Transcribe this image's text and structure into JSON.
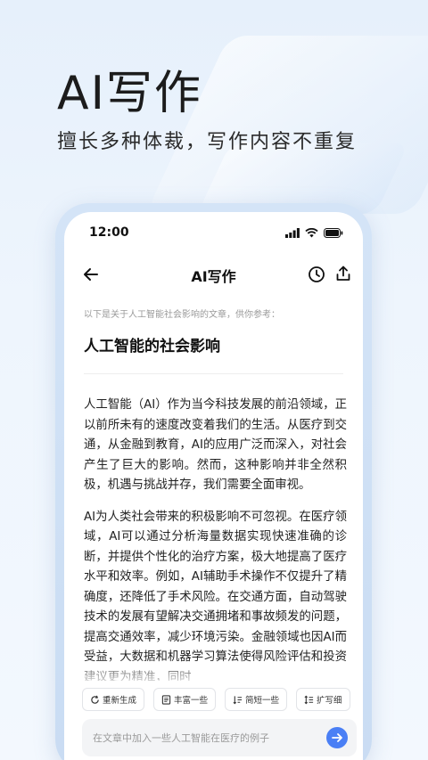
{
  "hero": {
    "title": "AI写作",
    "subtitle": "擅长多种体裁，写作内容不重复"
  },
  "status_bar": {
    "time": "12:00"
  },
  "navbar": {
    "title": "AI写作"
  },
  "article": {
    "intro": "以下是关于人工智能社会影响的文章，供你参考：",
    "title": "人工智能的社会影响",
    "paragraphs": [
      "人工智能（AI）作为当今科技发展的前沿领域，正以前所未有的速度改变着我们的生活。从医疗到交通，从金融到教育，AI的应用广泛而深入，对社会产生了巨大的影响。然而，这种影响并非全然积极，机遇与挑战并存，我们需要全面审视。",
      "AI为人类社会带来的积极影响不可忽视。在医疗领域，AI可以通过分析海量数据实现快速准确的诊断，并提供个性化的治疗方案，极大地提高了医疗水平和效率。例如，AI辅助手术操作不仅提升了精确度，还降低了手术风险。在交通方面，自动驾驶技术的发展有望解决交通拥堵和事故频发的问题，提高交通效率，减少环境污染。金融领域也因AI而受益，大数据和机器学习算法使得风险评估和投资建议更为精准，同时"
    ]
  },
  "chips": [
    {
      "label": "重新生成",
      "icon": "refresh-icon"
    },
    {
      "label": "丰富一些",
      "icon": "enrich-icon"
    },
    {
      "label": "简短一些",
      "icon": "shorten-icon"
    },
    {
      "label": "扩写细",
      "icon": "expand-icon"
    }
  ],
  "input": {
    "placeholder": "在文章中加入一些人工智能在医疗的例子"
  },
  "colors": {
    "accent": "#4a7ff5",
    "background": "#eaf2fc"
  }
}
